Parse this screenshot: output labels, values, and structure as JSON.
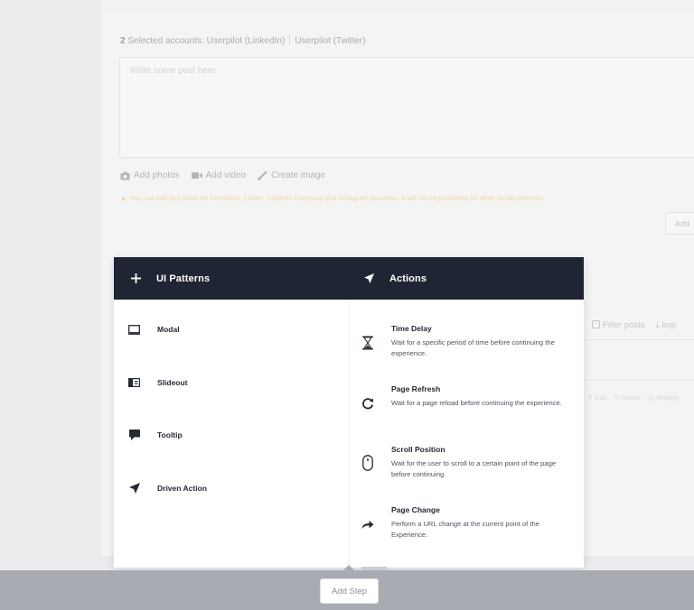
{
  "composer": {
    "selected_count": "2",
    "selected_label": "Selected accounts:",
    "accounts": [
      "Userpilot (LinkedIn)",
      "Userpilot (Twitter)"
    ],
    "post_placeholder": "Write some post here",
    "media": {
      "add_photos": "Add photos",
      "add_video": "Add video",
      "create_image": "Create image"
    },
    "warning": "You can add one video for Facebook, Twitter, LinkedIn Company and Instagram Business, it will not be published for other social networks.",
    "add_button": "Add",
    "filter_posts": "Filter posts",
    "import": "Imp",
    "row_actions": {
      "edit": "Edit",
      "reuse": "Reuse",
      "multiply": "Multiply"
    }
  },
  "popup": {
    "left_header": {
      "label": "UI Patterns",
      "icon": "plus-icon"
    },
    "right_header": {
      "label": "Actions",
      "icon": "navigation-arrow-icon"
    },
    "patterns": [
      {
        "label": "Modal",
        "icon": "modal-icon"
      },
      {
        "label": "Slideout",
        "icon": "slideout-icon"
      },
      {
        "label": "Tooltip",
        "icon": "tooltip-icon"
      },
      {
        "label": "Driven Action",
        "icon": "driven-action-icon"
      }
    ],
    "actions": [
      {
        "title": "Time Delay",
        "desc": "Wait for a specific period of time before continuing the experience.",
        "icon": "hourglass-icon"
      },
      {
        "title": "Page Refresh",
        "desc": "Wait for a page reload before continuing the experience.",
        "icon": "refresh-icon"
      },
      {
        "title": "Scroll Position",
        "desc": "Wait for the user to scroll to a certain point of the page before continuing.",
        "icon": "mouse-icon"
      },
      {
        "title": "Page Change",
        "desc": "Perform a URL change at the current point of the Experience.",
        "icon": "share-arrow-icon"
      }
    ]
  },
  "footer": {
    "add_step": "Add Step"
  },
  "colors": {
    "header_bg": "#1f2533",
    "bottom_bar": "#a8abb1",
    "warning": "#f2d8a2"
  }
}
